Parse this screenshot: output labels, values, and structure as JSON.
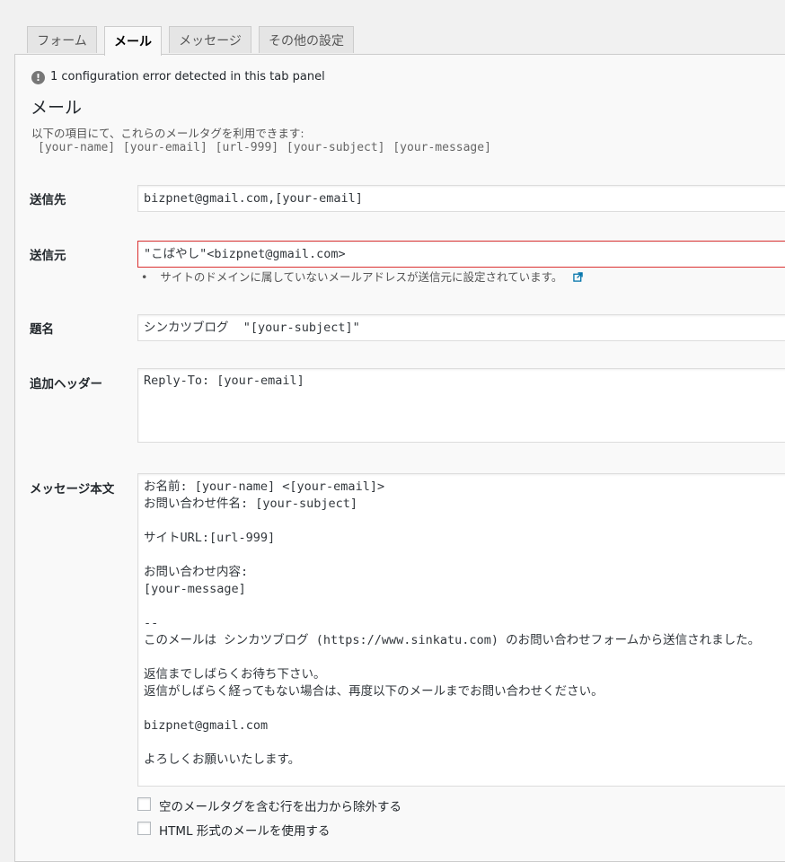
{
  "tabs": [
    {
      "label": "フォーム",
      "active": false
    },
    {
      "label": "メール",
      "active": true
    },
    {
      "label": "メッセージ",
      "active": false
    },
    {
      "label": "その他の設定",
      "active": false
    }
  ],
  "notice": {
    "icon": "exclamation-circle-icon",
    "text": "1 configuration error detected in this tab panel"
  },
  "section": {
    "title": "メール",
    "description": "以下の項目にて、これらのメールタグを利用できます:",
    "mail_tags": "[your-name] [your-email] [url-999] [your-subject] [your-message]"
  },
  "fields": {
    "recipient": {
      "label": "送信先",
      "value": "bizpnet@gmail.com,[your-email]"
    },
    "sender": {
      "label": "送信元",
      "value": "\"こばやし\"<bizpnet@gmail.com>",
      "warning": "サイトのドメインに属していないメールアドレスが送信元に設定されています。",
      "warning_icon": "external-link-icon"
    },
    "subject": {
      "label": "題名",
      "value": "シンカツブログ  \"[your-subject]\""
    },
    "additional_headers": {
      "label": "追加ヘッダー",
      "value": "Reply-To: [your-email]"
    },
    "message_body": {
      "label": "メッセージ本文",
      "value": "お名前: [your-name] <[your-email]>\nお問い合わせ件名: [your-subject]\n\nサイトURL:[url-999]\n\nお問い合わせ内容:\n[your-message]\n\n--\nこのメールは シンカツブログ (https://www.sinkatu.com) のお問い合わせフォームから送信されました。\n\n返信までしばらくお待ち下さい。\n返信がしばらく経ってもない場合は、再度以下のメールまでお問い合わせください。\n\nbizpnet@gmail.com\n\nよろしくお願いいたします。"
    }
  },
  "options": [
    {
      "label": "空のメールタグを含む行を出力から除外する",
      "checked": false
    },
    {
      "label": "HTML 形式のメールを使用する",
      "checked": false
    }
  ],
  "colors": {
    "error_border": "#dc3232",
    "link_blue": "#0073aa"
  }
}
